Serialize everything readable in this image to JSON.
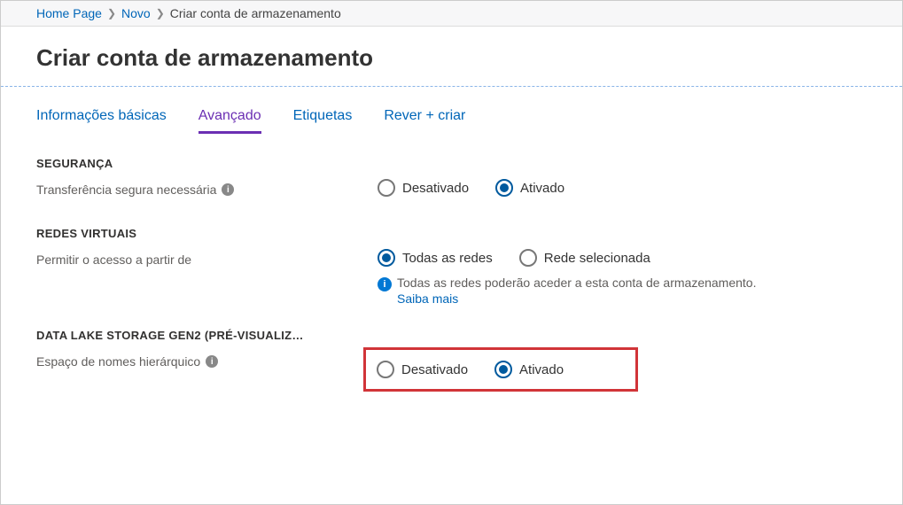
{
  "breadcrumb": {
    "home": "Home Page",
    "novo": "Novo",
    "current": "Criar conta de armazenamento"
  },
  "page_title": "Criar conta de armazenamento",
  "tabs": [
    {
      "label": "Informações básicas"
    },
    {
      "label": "Avançado"
    },
    {
      "label": "Etiquetas"
    },
    {
      "label": "Rever + criar"
    }
  ],
  "sections": {
    "security": {
      "heading": "SEGURANÇA",
      "secure_transfer": {
        "label": "Transferência segura necessária",
        "off": "Desativado",
        "on": "Ativado"
      }
    },
    "vnet": {
      "heading": "REDES VIRTUAIS",
      "allow_access": {
        "label": "Permitir o acesso a partir de",
        "all": "Todas as redes",
        "selected": "Rede selecionada",
        "helper_text": "Todas as redes poderão aceder a esta conta de armazenamento.",
        "learn_more": "Saiba mais"
      }
    },
    "gen2": {
      "heading": "DATA LAKE STORAGE GEN2 (PRÉ-VISUALIZ…",
      "hns": {
        "label": "Espaço de nomes hierárquico",
        "off": "Desativado",
        "on": "Ativado"
      }
    }
  }
}
